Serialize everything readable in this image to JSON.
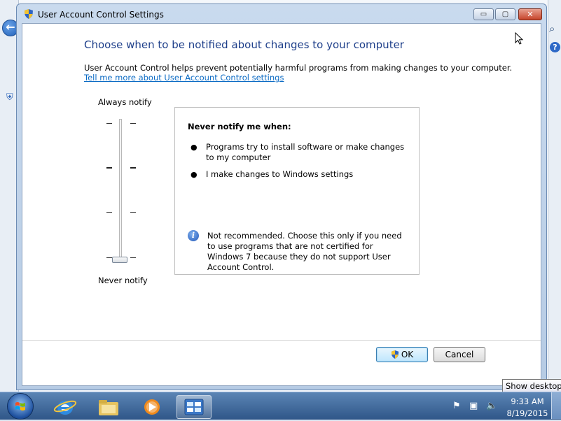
{
  "window": {
    "title": "User Account Control Settings",
    "minimize_glyph": "▭",
    "maximize_glyph": "▢",
    "close_glyph": "✕"
  },
  "content": {
    "heading": "Choose when to be notified about changes to your computer",
    "description": "User Account Control helps prevent potentially harmful programs from making changes to your computer.",
    "link": "Tell me more about User Account Control settings"
  },
  "slider": {
    "top_label": "Always notify",
    "bottom_label": "Never notify",
    "levels": 4,
    "selected_level": 1
  },
  "info": {
    "title": "Never notify me when:",
    "bullets": [
      "Programs try to install software or make changes to my computer",
      "I make changes to Windows settings"
    ],
    "warning": "Not recommended. Choose this only if you need to use programs that are not certified for Windows 7 because they do not support User Account Control."
  },
  "buttons": {
    "ok": "OK",
    "cancel": "Cancel"
  },
  "taskbar": {
    "time": "9:33 AM",
    "date": "8/19/2015",
    "tooltip": "Show desktop"
  },
  "colors": {
    "heading": "#1e3f8a",
    "link": "#0a6ac4"
  }
}
